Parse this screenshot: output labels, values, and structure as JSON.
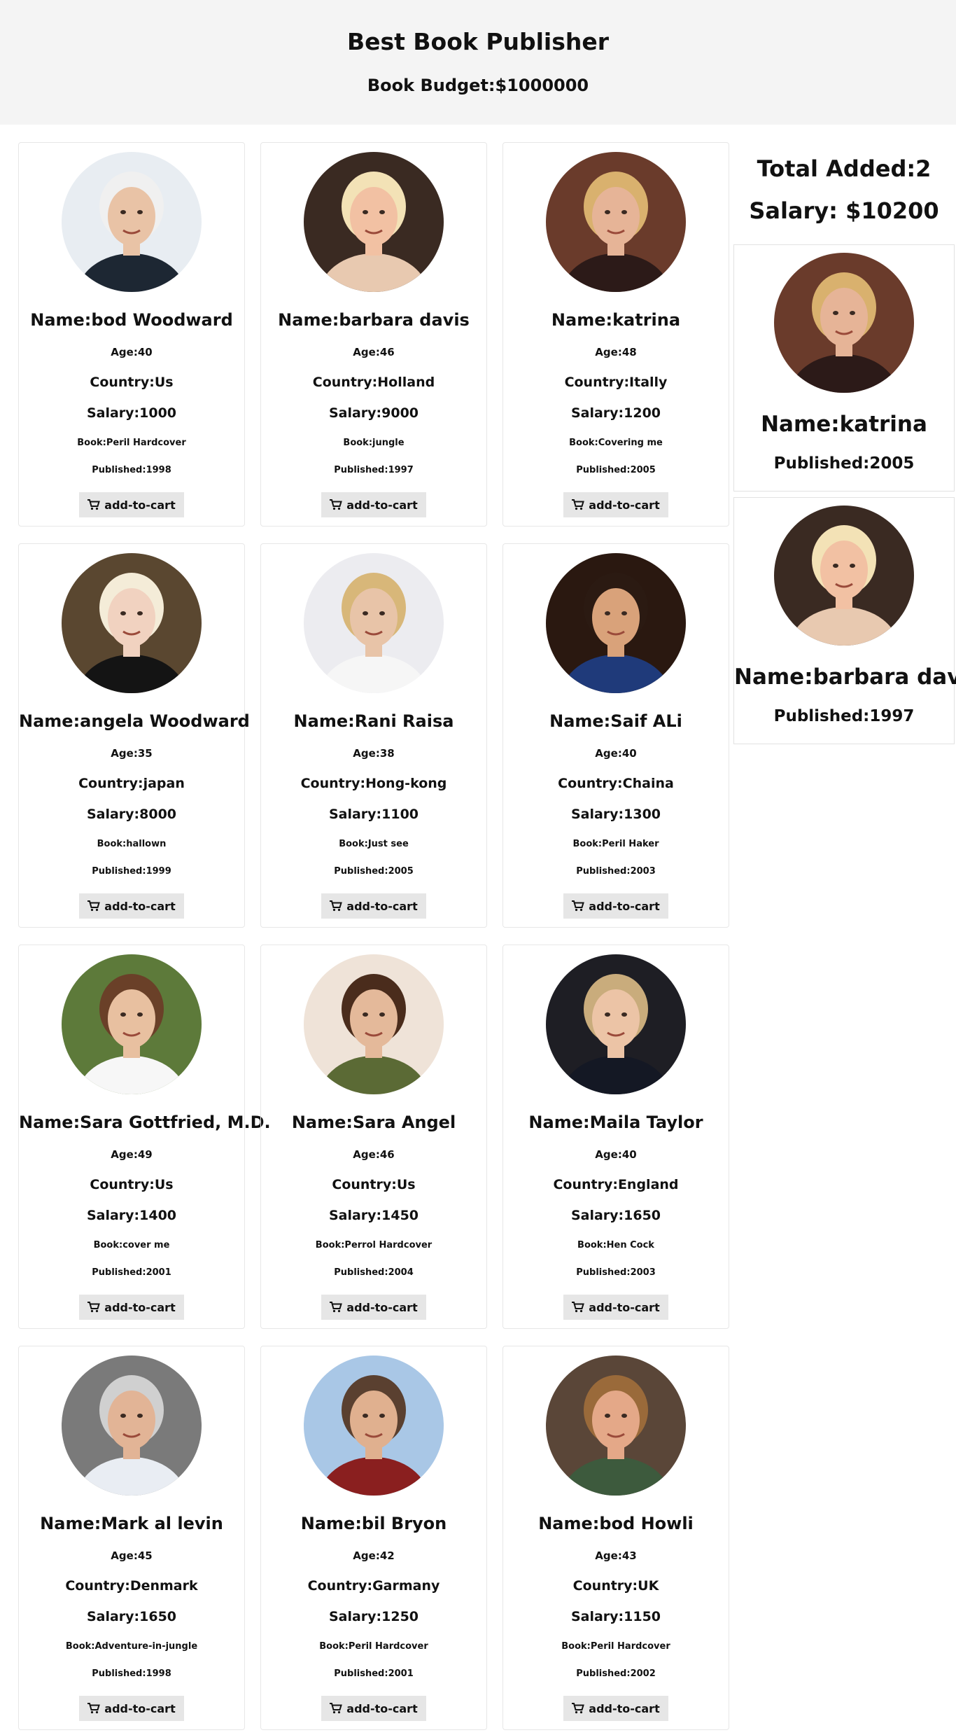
{
  "header": {
    "title": "Best Book Publisher",
    "budget": "Book Budget:$1000000"
  },
  "summary": {
    "total": "Total Added:2",
    "salary": "Salary: $10200"
  },
  "button_label": "add-to-cart",
  "authors": [
    {
      "name": "Name:bod Woodward",
      "age": "Age:40",
      "country": "Country:Us",
      "salary": "Salary:1000",
      "book": "Book:Peril Hardcover",
      "published": "Published:1998",
      "bg": "#e8edf2",
      "skin": "#e9c3a6",
      "hair": "#f0f0f0",
      "cloth": "#1d2733"
    },
    {
      "name": "Name:barbara davis",
      "age": "Age:46",
      "country": "Country:Holland",
      "salary": "Salary:9000",
      "book": "Book:jungle",
      "published": "Published:1997",
      "bg": "#3a2a22",
      "skin": "#f2c1a3",
      "hair": "#f3e2b6",
      "cloth": "#e8c9b0"
    },
    {
      "name": "Name:katrina",
      "age": "Age:48",
      "country": "Country:Itally",
      "salary": "Salary:1200",
      "book": "Book:Covering me",
      "published": "Published:2005",
      "bg": "#6a3b2b",
      "skin": "#e6b497",
      "hair": "#d9b16e",
      "cloth": "#2c1a18"
    },
    {
      "name": "Name:angela Woodward",
      "age": "Age:35",
      "country": "Country:japan",
      "salary": "Salary:8000",
      "book": "Book:hallown",
      "published": "Published:1999",
      "bg": "#5a4730",
      "skin": "#f1d2c0",
      "hair": "#f4ecd8",
      "cloth": "#141414"
    },
    {
      "name": "Name:Rani Raisa",
      "age": "Age:38",
      "country": "Country:Hong-kong",
      "salary": "Salary:1100",
      "book": "Book:Just see",
      "published": "Published:2005",
      "bg": "#ececf0",
      "skin": "#e8c4a8",
      "hair": "#d8b779",
      "cloth": "#f6f6f6"
    },
    {
      "name": "Name:Saif ALi",
      "age": "Age:40",
      "country": "Country:Chaina",
      "salary": "Salary:1300",
      "book": "Book:Peril Haker",
      "published": "Published:2003",
      "bg": "#2a1810",
      "skin": "#d9a27a",
      "hair": "#2b1a12",
      "cloth": "#1f3a7a"
    },
    {
      "name": "Name:Sara Gottfried, M.D.",
      "age": "Age:49",
      "country": "Country:Us",
      "salary": "Salary:1400",
      "book": "Book:cover me",
      "published": "Published:2001",
      "bg": "#5d7a3a",
      "skin": "#e8c0a0",
      "hair": "#6a4028",
      "cloth": "#f7f7f7"
    },
    {
      "name": "Name:Sara Angel",
      "age": "Age:46",
      "country": "Country:Us",
      "salary": "Salary:1450",
      "book": "Book:Perrol Hardcover",
      "published": "Published:2004",
      "bg": "#efe3d8",
      "skin": "#e4b99a",
      "hair": "#4a2c1c",
      "cloth": "#5b6a35"
    },
    {
      "name": "Name:Maila Taylor",
      "age": "Age:40",
      "country": "Country:England",
      "salary": "Salary:1650",
      "book": "Book:Hen Cock",
      "published": "Published:2003",
      "bg": "#1e1e24",
      "skin": "#ecc4a6",
      "hair": "#c9ac7c",
      "cloth": "#141824"
    },
    {
      "name": "Name:Mark al levin",
      "age": "Age:45",
      "country": "Country:Denmark",
      "salary": "Salary:1650",
      "book": "Book:Adventure-in-jungle",
      "published": "Published:1998",
      "bg": "#7a7a7a",
      "skin": "#e2b496",
      "hair": "#d0d0d0",
      "cloth": "#e9edf3"
    },
    {
      "name": "Name:bil Bryon",
      "age": "Age:42",
      "country": "Country:Garmany",
      "salary": "Salary:1250",
      "book": "Book:Peril Hardcover",
      "published": "Published:2001",
      "bg": "#a9c7e6",
      "skin": "#e0b08f",
      "hair": "#5a4030",
      "cloth": "#8a1f1f"
    },
    {
      "name": "Name:bod Howli",
      "age": "Age:43",
      "country": "Country:UK",
      "salary": "Salary:1150",
      "book": "Book:Peril Hardcover",
      "published": "Published:2002",
      "bg": "#5a4638",
      "skin": "#e4a888",
      "hair": "#9a6a3a",
      "cloth": "#3d5a3d"
    }
  ],
  "cart": [
    {
      "name": "Name:katrina",
      "published": "Published:2005",
      "bg": "#6a3b2b",
      "skin": "#e6b497",
      "hair": "#d9b16e",
      "cloth": "#2c1a18"
    },
    {
      "name": "Name:barbara davis",
      "published": "Published:1997",
      "bg": "#3a2a22",
      "skin": "#f2c1a3",
      "hair": "#f3e2b6",
      "cloth": "#e8c9b0"
    }
  ]
}
